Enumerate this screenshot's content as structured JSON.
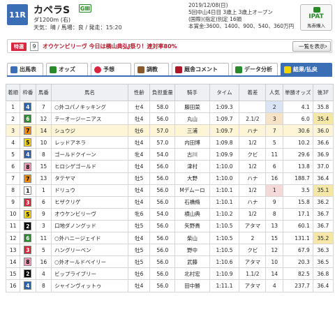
{
  "header": {
    "race_no": "11R",
    "race_name": "カペラS",
    "grade": "GⅢ",
    "distance": "ダ1200m (右)",
    "conditions": "天気：晴 / 馬場：良 / 発走：15:20",
    "date": "2019/12/08(日)",
    "meeting": "5回中山4日目 3歳上 3歳上オープン",
    "class": "(国際)(指定)別定 16頭",
    "prize": "本賞金:3600、1400、900、540、360万円"
  },
  "ipat": {
    "title": "IPAT",
    "sub": "馬券購入"
  },
  "special": {
    "tag": "特選",
    "num": "9",
    "text": "オウケンビリーヴ 今日は横山典弘J祭り！連対率80%",
    "button": "一覧を表示"
  },
  "tabs": [
    {
      "label": "出馬表",
      "color": "#3a6fb5"
    },
    {
      "label": "オッズ",
      "color": "#2a8a2a"
    },
    {
      "label": "予想",
      "color": "#d9263f"
    },
    {
      "label": "調教",
      "color": "#8a5a2a"
    },
    {
      "label": "厩舎コメント",
      "color": "#b0182a"
    },
    {
      "label": "データ分析",
      "color": "#2a8a2a"
    },
    {
      "label": "結果/払戻",
      "color": "#f2d400"
    }
  ],
  "table": {
    "headers": [
      "着順",
      "枠番",
      "馬番",
      "馬名",
      "性齢",
      "負担重量",
      "騎手",
      "タイム",
      "着差",
      "人気",
      "単勝オッズ",
      "後3F"
    ],
    "rows": [
      [
        "1",
        "4",
        "7",
        "○外コパノキッキング",
        "セ4",
        "58.0",
        "藤田菜",
        "1:09.3",
        "",
        "2",
        "4.1",
        "35.8"
      ],
      [
        "2",
        "6",
        "12",
        "テーオージーニアス",
        "牡4",
        "56.0",
        "丸山",
        "1:09.7",
        "2.1/2",
        "3",
        "6.0",
        "35.4"
      ],
      [
        "3",
        "7",
        "14",
        "シュウジ",
        "牡6",
        "57.0",
        "三浦",
        "1:09.7",
        "ハナ",
        "7",
        "30.6",
        "36.0"
      ],
      [
        "4",
        "5",
        "10",
        "レッドアネラ",
        "牡4",
        "57.0",
        "内田博",
        "1:09.8",
        "1/2",
        "5",
        "10.2",
        "36.6"
      ],
      [
        "5",
        "4",
        "8",
        "ゴールドクイーン",
        "牝4",
        "54.0",
        "古川",
        "1:09.9",
        "クビ",
        "11",
        "29.6",
        "36.9"
      ],
      [
        "6",
        "8",
        "15",
        "ヒロシゲゴールド",
        "牡4",
        "56.0",
        "津村",
        "1:10.0",
        "1/2",
        "6",
        "13.8",
        "37.0"
      ],
      [
        "7",
        "7",
        "13",
        "タテヤマ",
        "牡5",
        "56.0",
        "大野",
        "1:10.0",
        "ハナ",
        "16",
        "188.7",
        "36.4"
      ],
      [
        "8",
        "1",
        "1",
        "ドリュウ",
        "牡4",
        "56.0",
        "Mデムーロ",
        "1:10.1",
        "1/2",
        "1",
        "3.5",
        "35.1"
      ],
      [
        "9",
        "3",
        "6",
        "ヒザクリゲ",
        "牡4",
        "56.0",
        "石橋脩",
        "1:10.1",
        "ハナ",
        "9",
        "15.8",
        "36.2"
      ],
      [
        "10",
        "5",
        "9",
        "オウケンビリーヴ",
        "牝6",
        "54.0",
        "横山典",
        "1:10.2",
        "1/2",
        "8",
        "17.1",
        "36.7"
      ],
      [
        "11",
        "2",
        "3",
        "口地ダノングッド",
        "牡5",
        "56.0",
        "矢野貴",
        "1:10.5",
        "アタマ",
        "13",
        "60.1",
        "36.7"
      ],
      [
        "12",
        "6",
        "11",
        "○外ハニージェイド",
        "牡4",
        "56.0",
        "柴山",
        "1:10.5",
        "2",
        "15",
        "131.1",
        "35.2"
      ],
      [
        "13",
        "3",
        "5",
        "ハングリーベン",
        "牡5",
        "56.0",
        "野中",
        "1:10.5",
        "クビ",
        "12",
        "67.9",
        "36.3"
      ],
      [
        "14",
        "8",
        "16",
        "○外オールドベイリー",
        "牡5",
        "56.0",
        "武藤",
        "1:10.6",
        "アタマ",
        "10",
        "20.3",
        "36.5"
      ],
      [
        "15",
        "2",
        "4",
        "ビップライブリー",
        "牡6",
        "56.0",
        "北村宏",
        "1:10.9",
        "1.1/2",
        "14",
        "82.5",
        "36.8"
      ],
      [
        "16",
        "4",
        "8",
        "シャインヴィットゥ",
        "牡4",
        "56.0",
        "田中勝",
        "1:11.1",
        "アタマ",
        "4",
        "237.7",
        "36.4"
      ]
    ]
  },
  "colors": {
    "accent": "#3a6fb5",
    "highlight": "#fdf5d6"
  }
}
